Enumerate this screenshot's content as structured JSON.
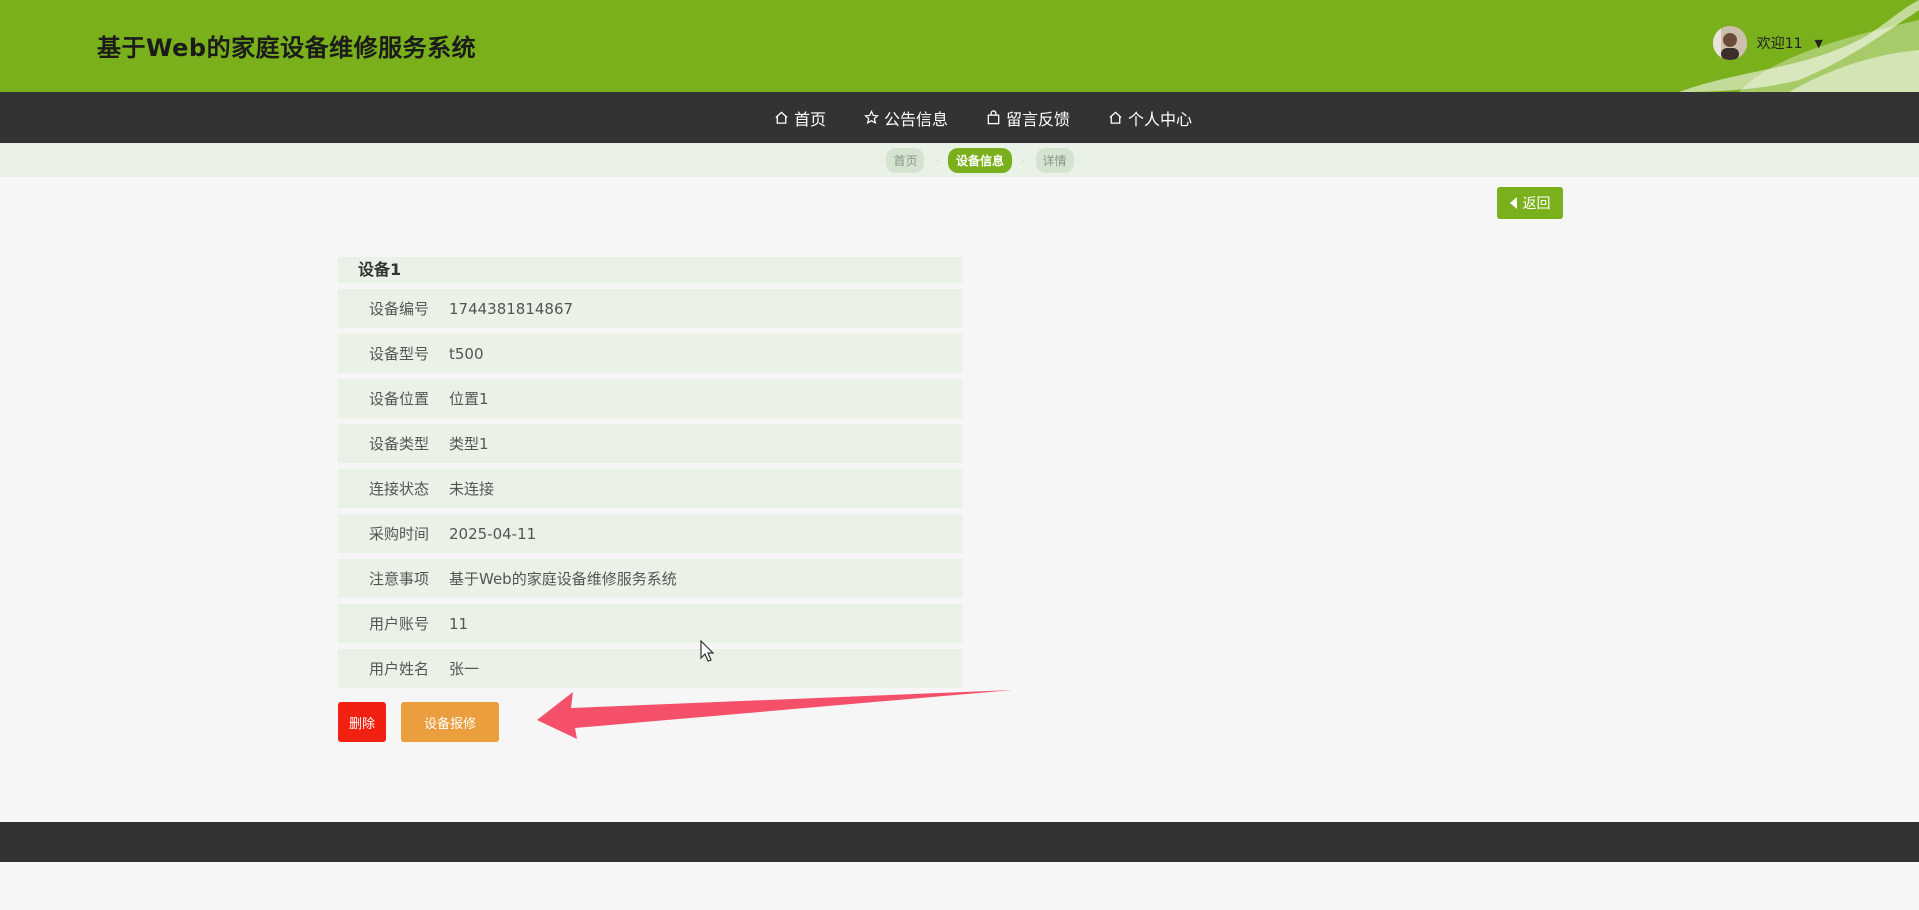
{
  "header": {
    "site_title": "基于Web的家庭设备维修服务系统",
    "user_greeting": "欢迎11"
  },
  "nav": {
    "items": [
      {
        "label": "首页",
        "icon": "home-icon"
      },
      {
        "label": "公告信息",
        "icon": "star-icon"
      },
      {
        "label": "留言反馈",
        "icon": "bag-icon"
      },
      {
        "label": "个人中心",
        "icon": "home-icon"
      }
    ]
  },
  "breadcrumb": {
    "items": [
      "首页",
      "设备信息",
      "详情"
    ],
    "active_index": 1
  },
  "back_button": {
    "label": "返回"
  },
  "detail": {
    "title": "设备1",
    "rows": [
      {
        "label": "设备编号",
        "value": "1744381814867"
      },
      {
        "label": "设备型号",
        "value": "t500"
      },
      {
        "label": "设备位置",
        "value": "位置1"
      },
      {
        "label": "设备类型",
        "value": "类型1"
      },
      {
        "label": "连接状态",
        "value": "未连接"
      },
      {
        "label": "采购时间",
        "value": "2025-04-11"
      },
      {
        "label": "注意事项",
        "value": "基于Web的家庭设备维修服务系统"
      },
      {
        "label": "用户账号",
        "value": "11"
      },
      {
        "label": "用户姓名",
        "value": "张一"
      }
    ]
  },
  "actions": {
    "delete_label": "删除",
    "repair_label": "设备报修"
  },
  "colors": {
    "primary_green": "#7ab01b",
    "nav_dark": "#333333",
    "danger_red": "#f22010",
    "warning_orange": "#ea9e3d",
    "annotation_arrow": "#f4506a"
  }
}
